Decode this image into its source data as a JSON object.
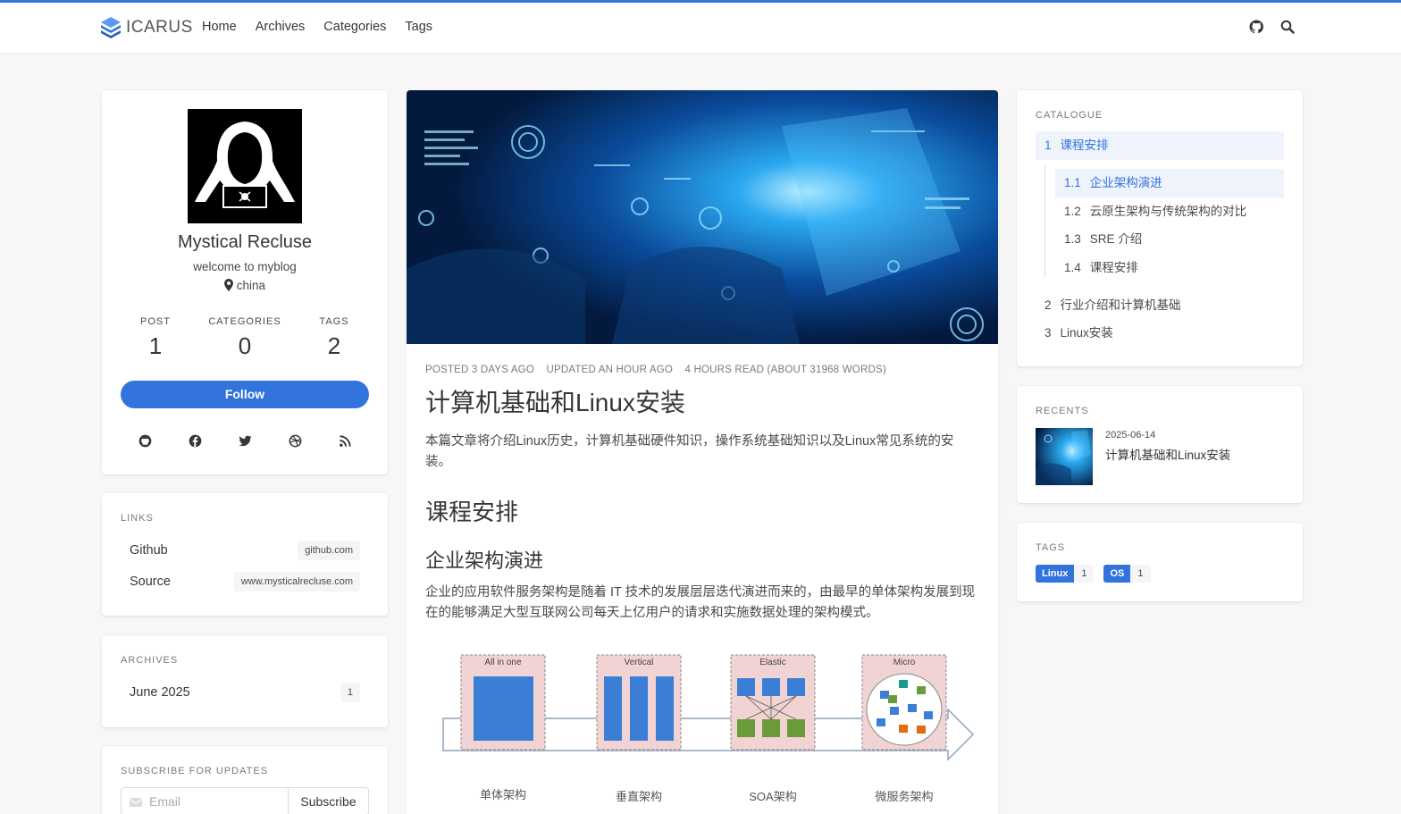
{
  "nav": {
    "brand": "ICARUS",
    "links": [
      "Home",
      "Archives",
      "Categories",
      "Tags"
    ]
  },
  "profile": {
    "name": "Mystical Recluse",
    "tagline": "welcome to myblog",
    "location": "china",
    "stats": [
      {
        "label": "POST",
        "value": "1"
      },
      {
        "label": "CATEGORIES",
        "value": "0"
      },
      {
        "label": "TAGS",
        "value": "2"
      }
    ],
    "follow_label": "Follow",
    "socials": [
      "github-icon",
      "facebook-icon",
      "twitter-icon",
      "dribbble-icon",
      "rss-icon"
    ]
  },
  "links": {
    "title": "LINKS",
    "items": [
      {
        "name": "Github",
        "url": "github.com"
      },
      {
        "name": "Source",
        "url": "www.mysticalrecluse.com"
      }
    ]
  },
  "archives": {
    "title": "ARCHIVES",
    "items": [
      {
        "label": "June 2025",
        "count": "1"
      }
    ]
  },
  "subscribe": {
    "title": "SUBSCRIBE FOR UPDATES",
    "placeholder": "Email",
    "button": "Subscribe"
  },
  "article": {
    "meta": [
      "POSTED 3 DAYS AGO",
      "UPDATED AN HOUR AGO",
      "4 HOURS READ (ABOUT 31968 WORDS)"
    ],
    "title": "计算机基础和Linux安装",
    "intro": "本篇文章将介绍Linux历史，计算机基础硬件知识，操作系统基础知识以及Linux常见系统的安装。",
    "h2": "课程安排",
    "h3": "企业架构演进",
    "para": "企业的应用软件服务架构是随着 IT 技术的发展层层迭代演进而来的，由最早的单体架构发展到现在的能够满足大型互联网公司每天上亿用户的请求和实施数据处理的架构模式。",
    "diagram": {
      "boxes": [
        "All in one",
        "Vertical",
        "Elastic",
        "Micro"
      ],
      "captions": [
        "单体架构",
        "垂直架构",
        "SOA架构",
        "微服务架构"
      ]
    }
  },
  "catalogue": {
    "title": "CATALOGUE",
    "items": [
      {
        "num": "1",
        "label": "课程安排",
        "active": true
      },
      {
        "num": "1.1",
        "label": "企业架构演进",
        "active": true
      },
      {
        "num": "1.2",
        "label": "云原生架构与传统架构的对比",
        "active": false
      },
      {
        "num": "1.3",
        "label": "SRE 介绍",
        "active": false
      },
      {
        "num": "1.4",
        "label": "课程安排",
        "active": false
      },
      {
        "num": "2",
        "label": "行业介绍和计算机基础",
        "active": false
      },
      {
        "num": "3",
        "label": "Linux安装",
        "active": false
      }
    ]
  },
  "recents": {
    "title": "RECENTS",
    "items": [
      {
        "date": "2025-06-14",
        "title": "计算机基础和Linux安装"
      }
    ]
  },
  "tags": {
    "title": "TAGS",
    "items": [
      {
        "name": "Linux",
        "count": "1"
      },
      {
        "name": "OS",
        "count": "1"
      }
    ]
  },
  "colors": {
    "accent": "#3273dc",
    "background": "#f7f7f7"
  }
}
